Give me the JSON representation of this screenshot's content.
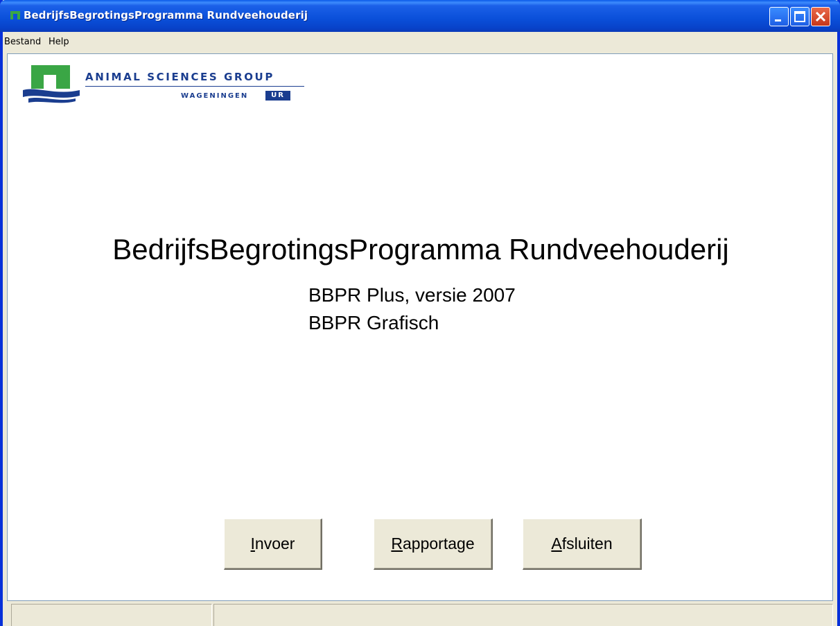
{
  "window": {
    "title": "BedrijfsBegrotingsProgramma Rundveehouderij",
    "accent": "#0a4fd9",
    "controls": [
      "minimize-icon",
      "maximize-icon",
      "close-icon"
    ]
  },
  "menu": {
    "items": [
      {
        "label": "Bestand"
      },
      {
        "label": "Help"
      }
    ]
  },
  "logo": {
    "line1": "ANIMAL SCIENCES GROUP",
    "line2": "WAGENINGEN",
    "badge": "UR",
    "brand_green": "#3aa645",
    "brand_blue": "#1a3d8f"
  },
  "main": {
    "title": "BedrijfsBegrotingsProgramma Rundveehouderij",
    "subtitle1": "BBPR Plus, versie 2007",
    "subtitle2": "BBPR Grafisch"
  },
  "buttons": {
    "invoer": {
      "mnemonic": "I",
      "rest": "nvoer"
    },
    "rapportage": {
      "mnemonic": "R",
      "rest": "apportage"
    },
    "afsluiten": {
      "mnemonic": "A",
      "rest": "fsluiten"
    }
  },
  "status": {
    "pane1": "",
    "pane2": ""
  }
}
